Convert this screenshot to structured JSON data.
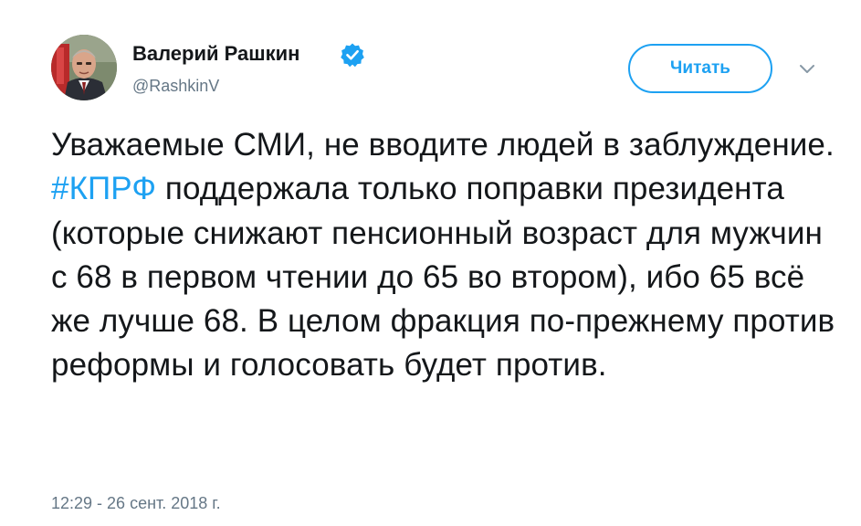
{
  "author": {
    "display_name": "Валерий Рашкин",
    "handle": "@RashkinV",
    "verified": true,
    "avatar_icon": "profile-photo"
  },
  "follow_button": {
    "label": "Читать"
  },
  "menu_icon": "chevron-down-icon",
  "tweet": {
    "text_before_hashtag": "Уважаемые СМИ, не вводите людей в заблуждение. ",
    "hashtag": "#КПРФ",
    "text_after_hashtag": " поддержала только поправки президента (которые снижают пенсионный возраст для мужчин с 68 в первом чтении до 65 во втором), ибо 65 всё же лучше 68. В целом фракция по-прежнему против реформы и голосовать будет против."
  },
  "timestamp": "12:29 - 26 сент. 2018 г.",
  "colors": {
    "accent": "#1da1f2",
    "text": "#14171a",
    "secondary_text": "#657786"
  }
}
